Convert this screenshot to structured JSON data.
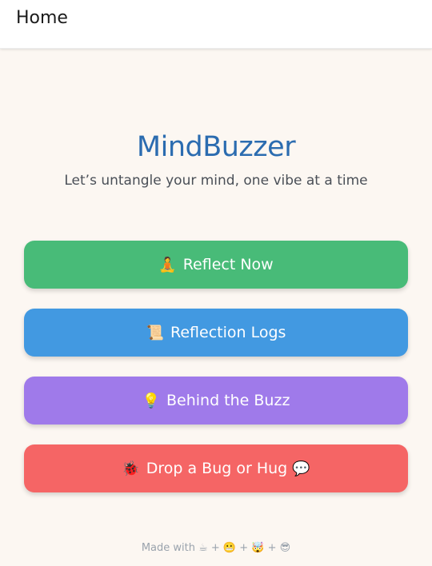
{
  "appbar": {
    "title": "Home"
  },
  "hero": {
    "title": "MindBuzzer",
    "tagline": "Let’s untangle your mind, one vibe at a time"
  },
  "menu": [
    {
      "icon": "🧘",
      "icon_name": "meditation-icon",
      "label": "Reflect Now",
      "color": "#48bb78"
    },
    {
      "icon": "📜",
      "icon_name": "scroll-icon",
      "label": "Reflection Logs",
      "color": "#4299e1"
    },
    {
      "icon": "💡",
      "icon_name": "lightbulb-icon",
      "label": "Behind the Buzz",
      "color": "#9f7aea"
    },
    {
      "icon": "🐞",
      "icon_name": "ladybug-icon",
      "label": "Drop a Bug or Hug",
      "trailing_icon": "💬",
      "trailing_icon_name": "speech-bubble-icon",
      "color": "#f56565"
    }
  ],
  "footer": {
    "text": "Made with ☕ + 😬 + 🤯 + 😎"
  },
  "colors": {
    "background": "#fcf7f2",
    "brand": "#2b6cb0"
  }
}
